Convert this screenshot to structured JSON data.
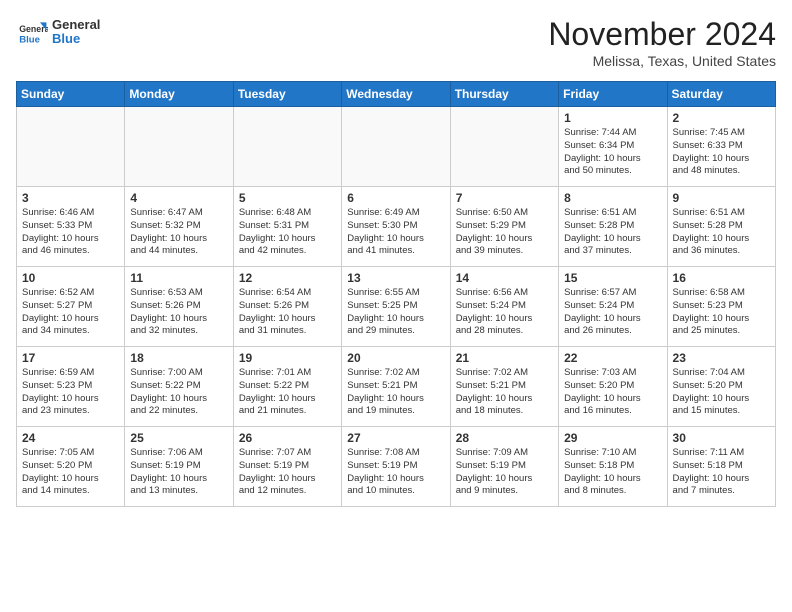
{
  "header": {
    "logo": {
      "general": "General",
      "blue": "Blue"
    },
    "title": "November 2024",
    "location": "Melissa, Texas, United States"
  },
  "days_of_week": [
    "Sunday",
    "Monday",
    "Tuesday",
    "Wednesday",
    "Thursday",
    "Friday",
    "Saturday"
  ],
  "weeks": [
    [
      {
        "day": "",
        "content": ""
      },
      {
        "day": "",
        "content": ""
      },
      {
        "day": "",
        "content": ""
      },
      {
        "day": "",
        "content": ""
      },
      {
        "day": "",
        "content": ""
      },
      {
        "day": "1",
        "content": "Sunrise: 7:44 AM\nSunset: 6:34 PM\nDaylight: 10 hours\nand 50 minutes."
      },
      {
        "day": "2",
        "content": "Sunrise: 7:45 AM\nSunset: 6:33 PM\nDaylight: 10 hours\nand 48 minutes."
      }
    ],
    [
      {
        "day": "3",
        "content": "Sunrise: 6:46 AM\nSunset: 5:33 PM\nDaylight: 10 hours\nand 46 minutes."
      },
      {
        "day": "4",
        "content": "Sunrise: 6:47 AM\nSunset: 5:32 PM\nDaylight: 10 hours\nand 44 minutes."
      },
      {
        "day": "5",
        "content": "Sunrise: 6:48 AM\nSunset: 5:31 PM\nDaylight: 10 hours\nand 42 minutes."
      },
      {
        "day": "6",
        "content": "Sunrise: 6:49 AM\nSunset: 5:30 PM\nDaylight: 10 hours\nand 41 minutes."
      },
      {
        "day": "7",
        "content": "Sunrise: 6:50 AM\nSunset: 5:29 PM\nDaylight: 10 hours\nand 39 minutes."
      },
      {
        "day": "8",
        "content": "Sunrise: 6:51 AM\nSunset: 5:28 PM\nDaylight: 10 hours\nand 37 minutes."
      },
      {
        "day": "9",
        "content": "Sunrise: 6:51 AM\nSunset: 5:28 PM\nDaylight: 10 hours\nand 36 minutes."
      }
    ],
    [
      {
        "day": "10",
        "content": "Sunrise: 6:52 AM\nSunset: 5:27 PM\nDaylight: 10 hours\nand 34 minutes."
      },
      {
        "day": "11",
        "content": "Sunrise: 6:53 AM\nSunset: 5:26 PM\nDaylight: 10 hours\nand 32 minutes."
      },
      {
        "day": "12",
        "content": "Sunrise: 6:54 AM\nSunset: 5:26 PM\nDaylight: 10 hours\nand 31 minutes."
      },
      {
        "day": "13",
        "content": "Sunrise: 6:55 AM\nSunset: 5:25 PM\nDaylight: 10 hours\nand 29 minutes."
      },
      {
        "day": "14",
        "content": "Sunrise: 6:56 AM\nSunset: 5:24 PM\nDaylight: 10 hours\nand 28 minutes."
      },
      {
        "day": "15",
        "content": "Sunrise: 6:57 AM\nSunset: 5:24 PM\nDaylight: 10 hours\nand 26 minutes."
      },
      {
        "day": "16",
        "content": "Sunrise: 6:58 AM\nSunset: 5:23 PM\nDaylight: 10 hours\nand 25 minutes."
      }
    ],
    [
      {
        "day": "17",
        "content": "Sunrise: 6:59 AM\nSunset: 5:23 PM\nDaylight: 10 hours\nand 23 minutes."
      },
      {
        "day": "18",
        "content": "Sunrise: 7:00 AM\nSunset: 5:22 PM\nDaylight: 10 hours\nand 22 minutes."
      },
      {
        "day": "19",
        "content": "Sunrise: 7:01 AM\nSunset: 5:22 PM\nDaylight: 10 hours\nand 21 minutes."
      },
      {
        "day": "20",
        "content": "Sunrise: 7:02 AM\nSunset: 5:21 PM\nDaylight: 10 hours\nand 19 minutes."
      },
      {
        "day": "21",
        "content": "Sunrise: 7:02 AM\nSunset: 5:21 PM\nDaylight: 10 hours\nand 18 minutes."
      },
      {
        "day": "22",
        "content": "Sunrise: 7:03 AM\nSunset: 5:20 PM\nDaylight: 10 hours\nand 16 minutes."
      },
      {
        "day": "23",
        "content": "Sunrise: 7:04 AM\nSunset: 5:20 PM\nDaylight: 10 hours\nand 15 minutes."
      }
    ],
    [
      {
        "day": "24",
        "content": "Sunrise: 7:05 AM\nSunset: 5:20 PM\nDaylight: 10 hours\nand 14 minutes."
      },
      {
        "day": "25",
        "content": "Sunrise: 7:06 AM\nSunset: 5:19 PM\nDaylight: 10 hours\nand 13 minutes."
      },
      {
        "day": "26",
        "content": "Sunrise: 7:07 AM\nSunset: 5:19 PM\nDaylight: 10 hours\nand 12 minutes."
      },
      {
        "day": "27",
        "content": "Sunrise: 7:08 AM\nSunset: 5:19 PM\nDaylight: 10 hours\nand 10 minutes."
      },
      {
        "day": "28",
        "content": "Sunrise: 7:09 AM\nSunset: 5:19 PM\nDaylight: 10 hours\nand 9 minutes."
      },
      {
        "day": "29",
        "content": "Sunrise: 7:10 AM\nSunset: 5:18 PM\nDaylight: 10 hours\nand 8 minutes."
      },
      {
        "day": "30",
        "content": "Sunrise: 7:11 AM\nSunset: 5:18 PM\nDaylight: 10 hours\nand 7 minutes."
      }
    ]
  ]
}
